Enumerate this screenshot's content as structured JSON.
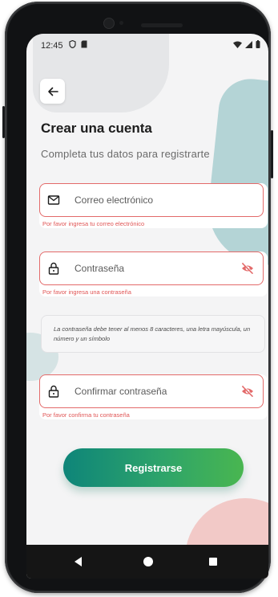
{
  "status_bar": {
    "time": "12:45",
    "left_icons": [
      "shield-icon",
      "sim-card-icon"
    ],
    "right_icons": [
      "wifi-icon",
      "signal-icon",
      "battery-icon"
    ]
  },
  "header": {
    "back_icon": "arrow-left-icon",
    "title": "Crear una cuenta",
    "subtitle": "Completa tus datos para registrarte"
  },
  "form": {
    "email": {
      "placeholder": "Correo electrónico",
      "icon": "mail-icon",
      "error": "Por favor ingresa tu correo electrónico"
    },
    "password": {
      "placeholder": "Contraseña",
      "icon": "lock-icon",
      "toggle_icon": "eye-off-icon",
      "error": "Por favor ingresa una contraseña"
    },
    "password_hint": "La contraseña debe tener al menos 8 caracteres, una letra mayúscula, un número y un símbolo",
    "confirm_password": {
      "placeholder": "Confirmar contraseña",
      "icon": "lock-icon",
      "toggle_icon": "eye-off-icon",
      "error": "Por favor confirma tu contraseña"
    },
    "submit_label": "Registrarse"
  },
  "colors": {
    "error": "#e05555",
    "field_border": "#e36a6a",
    "button_gradient_start": "#0e8579",
    "button_gradient_end": "#49b650",
    "accent_teal": "#a8ced0",
    "accent_pink": "#f2c9c7"
  },
  "nav_bar": {
    "icons": [
      "nav-back-icon",
      "nav-home-icon",
      "nav-recents-icon"
    ]
  }
}
